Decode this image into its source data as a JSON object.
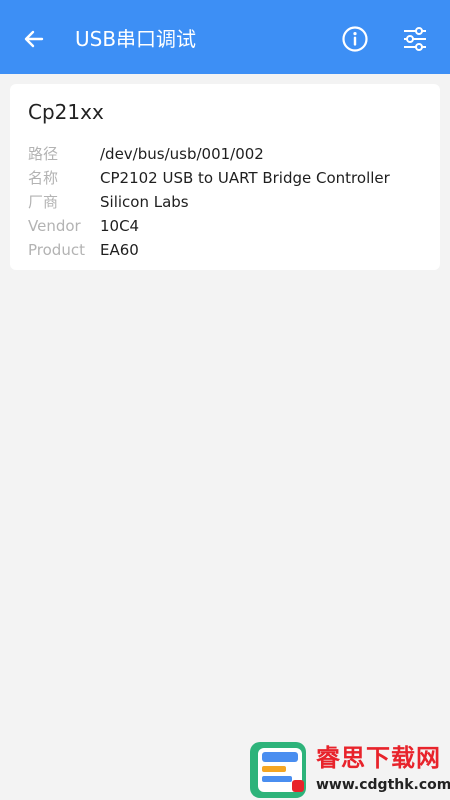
{
  "appbar": {
    "title": "USB串口调试",
    "back_icon": "arrow-left-icon",
    "info_icon": "info-circle-icon",
    "settings_icon": "sliders-icon",
    "color": "#3d8ff5"
  },
  "device": {
    "name": "Cp21xx",
    "fields": [
      {
        "label": "路径",
        "value": "/dev/bus/usb/001/002"
      },
      {
        "label": "名称",
        "value": "CP2102 USB to UART Bridge Controller"
      },
      {
        "label": "厂商",
        "value": "Silicon Labs"
      },
      {
        "label": "Vendor",
        "value": "10C4"
      },
      {
        "label": "Product",
        "value": "EA60"
      }
    ]
  },
  "watermark": {
    "title": "睿思下载网",
    "url": "www.cdgthk.com"
  }
}
